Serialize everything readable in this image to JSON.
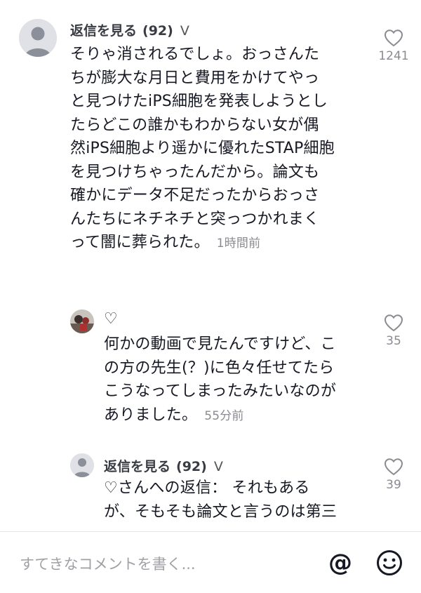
{
  "comment1": {
    "username": "返信を見る",
    "count": "(92)",
    "chevron": "V",
    "lines": [
      "そりゃ消されるでしょ。おっさんた",
      "ちが膨大な月日と費用をかけてやっ",
      "と見つけたiPS細胞を発表しようとし",
      "たらどこの誰かもわからない女が偶",
      "然iPS細胞より遥かに優れたSTAP細胞",
      "を見つけちゃったんだから。論文も",
      "確かにデータ不足だったからおっさ",
      "んたちにネチネチと突っつかれまく",
      "って闇に葬られた。"
    ],
    "timestamp": "1時間前",
    "likes": "1241"
  },
  "reply1": {
    "username": "♡",
    "lines": [
      "何かの動画で見たんですけど、こ",
      "の方の先生(？)に色々任せてたら",
      "こうなってしまったみたいなのが",
      "ありました。"
    ],
    "timestamp": "55分前",
    "likes": "35"
  },
  "reply2": {
    "username": "返信を見る",
    "count": "(92)",
    "chevron": "V",
    "lines": [
      "♡さんへの返信： それもある",
      "が、そもそも論文と言うのは第三"
    ],
    "likes": "39"
  },
  "input": {
    "placeholder": "すてきなコメントを書く...",
    "at_icon": "@"
  },
  "icons": {
    "like": "heart-outline-icon",
    "avatar": "default-avatar-icon",
    "mention": "at-icon",
    "emoji": "smiley-icon"
  }
}
